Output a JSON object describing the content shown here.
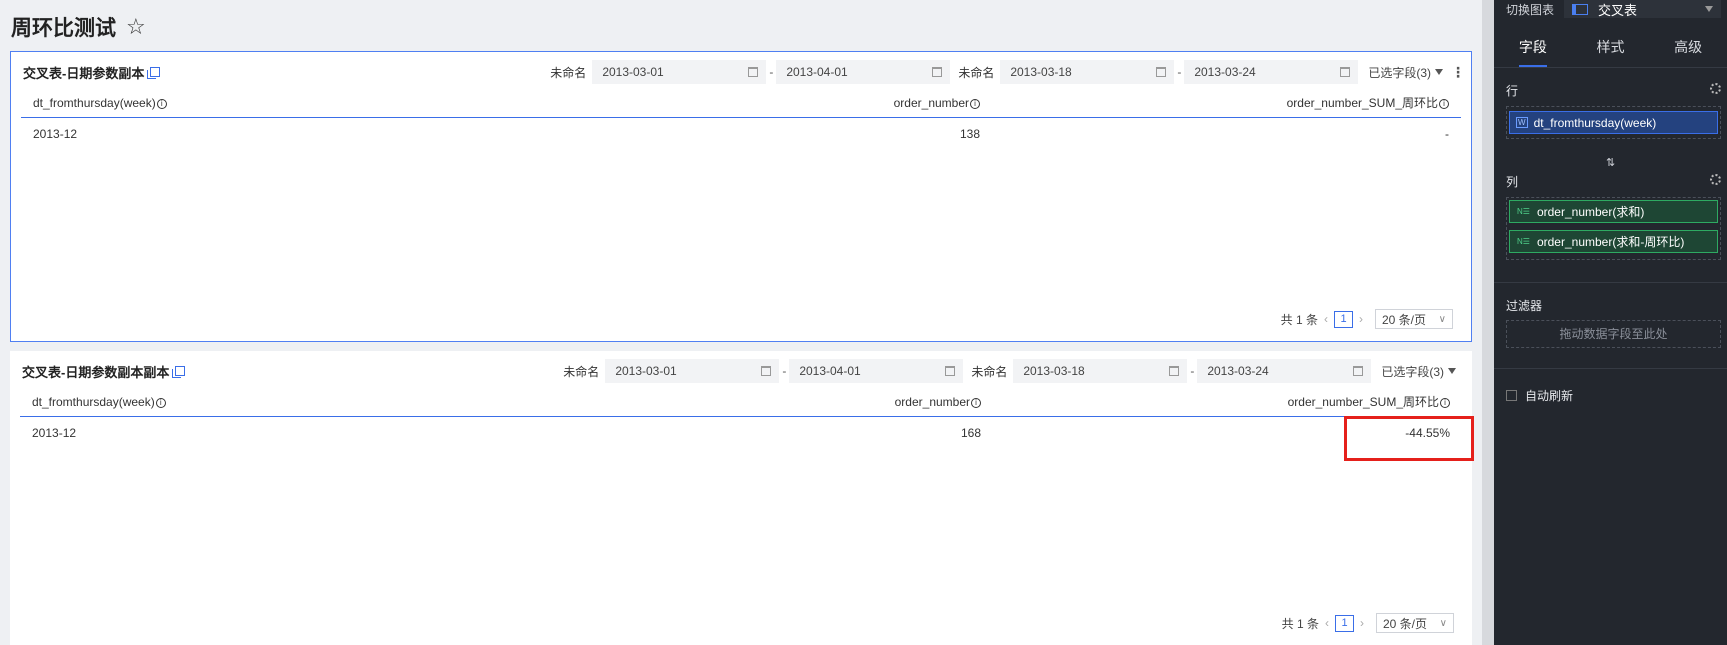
{
  "page": {
    "title": "周环比测试"
  },
  "panels": [
    {
      "title": "交叉表-日期参数副本",
      "filters": [
        {
          "label": "未命名",
          "start": "2013-03-01",
          "end": "2013-04-01"
        },
        {
          "label": "未命名",
          "start": "2013-03-18",
          "end": "2013-03-24"
        }
      ],
      "selected_fields": "已选字段(3)",
      "columns": [
        "dt_fromthursday(week)",
        "order_number",
        "order_number_SUM_周环比"
      ],
      "rows": [
        [
          "2013-12",
          "138",
          "-"
        ]
      ],
      "pager": {
        "total": "共 1 条",
        "page": "1",
        "size": "20 条/页"
      }
    },
    {
      "title": "交叉表-日期参数副本副本",
      "filters": [
        {
          "label": "未命名",
          "start": "2013-03-01",
          "end": "2013-04-01"
        },
        {
          "label": "未命名",
          "start": "2013-03-18",
          "end": "2013-03-24"
        }
      ],
      "selected_fields": "已选字段(3)",
      "columns": [
        "dt_fromthursday(week)",
        "order_number",
        "order_number_SUM_周环比"
      ],
      "rows": [
        [
          "2013-12",
          "168",
          "-44.55%"
        ]
      ],
      "pager": {
        "total": "共 1 条",
        "page": "1",
        "size": "20 条/页"
      }
    }
  ],
  "right_panel": {
    "switch_label": "切换图表",
    "chart_type": "交叉表",
    "tabs": [
      "字段",
      "样式",
      "高级"
    ],
    "rows_title": "行",
    "row_fields": [
      {
        "tag": "W",
        "label": "dt_fromthursday(week)"
      }
    ],
    "cols_title": "列",
    "col_fields": [
      {
        "tag": "N☰",
        "label": "order_number(求和)"
      },
      {
        "tag": "N☰",
        "label": "order_number(求和-周环比)"
      }
    ],
    "filter_title": "过滤器",
    "filter_placeholder": "拖动数据字段至此处",
    "auto_refresh": "自动刷新"
  },
  "colors": {
    "accent": "#3a6ee8",
    "highlight": "#e5201b",
    "sidebar_bg": "#23272e"
  }
}
